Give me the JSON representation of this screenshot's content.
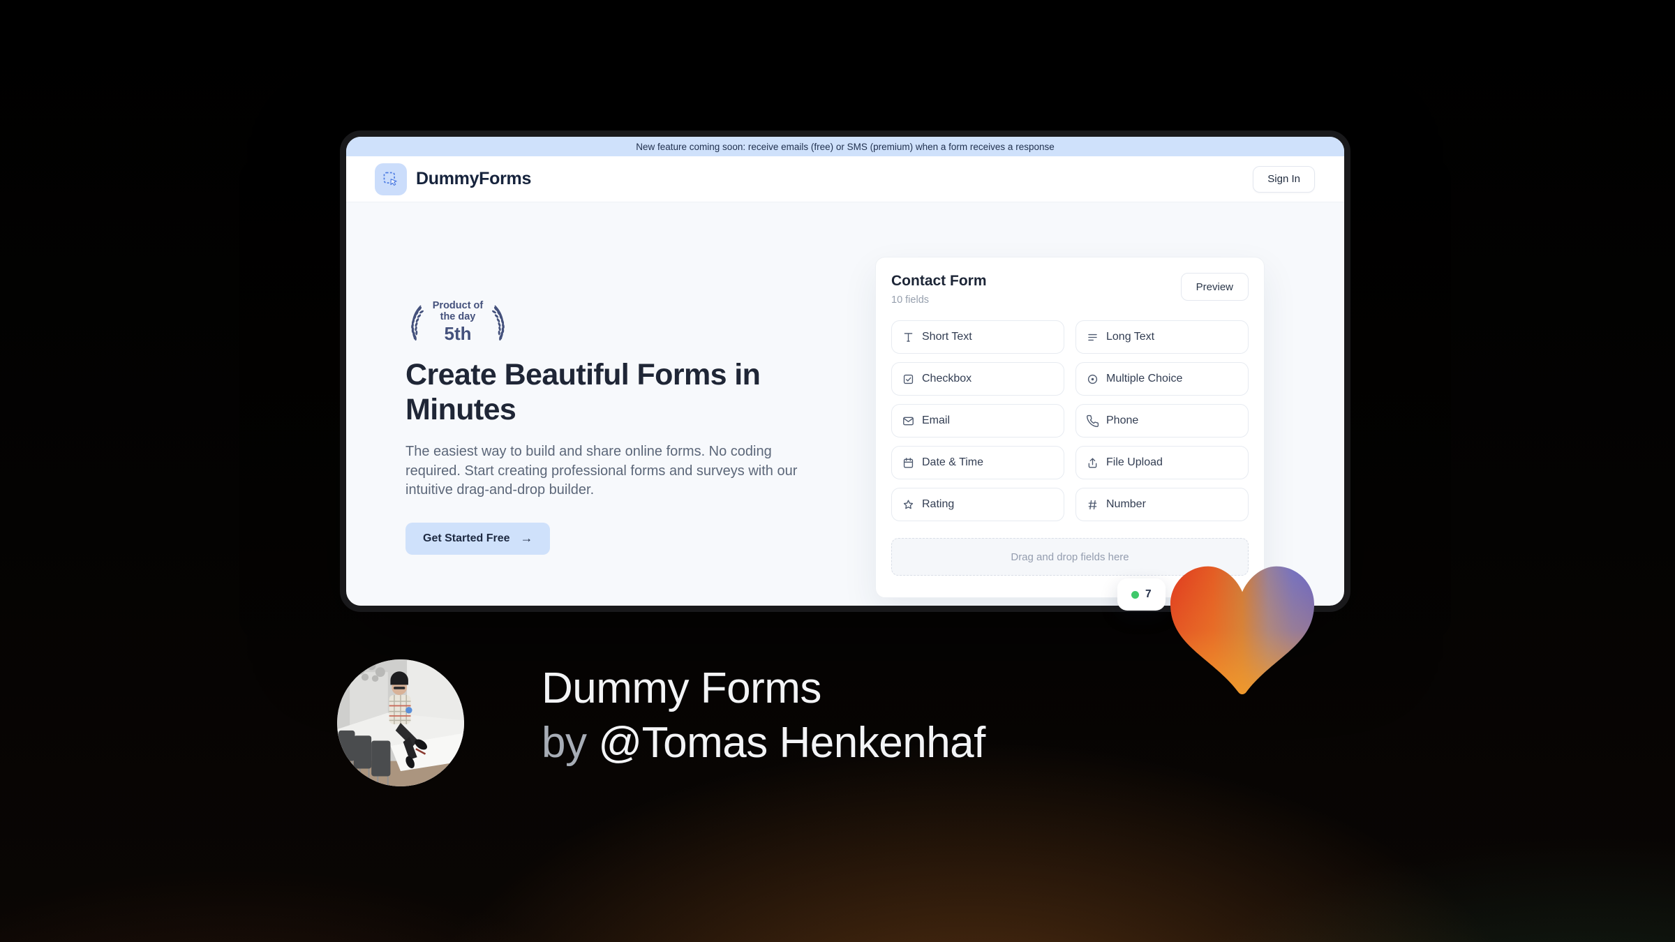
{
  "banner": {
    "text": "New feature coming soon: receive emails (free) or SMS (premium) when a form receives a response"
  },
  "header": {
    "brand": "DummyForms",
    "sign_in_label": "Sign In"
  },
  "hero": {
    "badge": {
      "title": "Product of the day",
      "rank": "5th"
    },
    "title": "Create Beautiful Forms in Minutes",
    "description": "The easiest way to build and share online forms. No coding required. Start creating professional forms and surveys with our intuitive drag-and-drop builder.",
    "cta_label": "Get Started Free",
    "cta_arrow": "→"
  },
  "form_builder": {
    "title": "Contact Form",
    "subtitle": "10 fields",
    "preview_label": "Preview",
    "fields": [
      {
        "label": "Short Text",
        "icon": "short-text-icon"
      },
      {
        "label": "Long Text",
        "icon": "long-text-icon"
      },
      {
        "label": "Checkbox",
        "icon": "checkbox-icon"
      },
      {
        "label": "Multiple Choice",
        "icon": "radio-icon"
      },
      {
        "label": "Email",
        "icon": "email-icon"
      },
      {
        "label": "Phone",
        "icon": "phone-icon"
      },
      {
        "label": "Date & Time",
        "icon": "calendar-icon"
      },
      {
        "label": "File Upload",
        "icon": "upload-icon"
      },
      {
        "label": "Rating",
        "icon": "star-icon"
      },
      {
        "label": "Number",
        "icon": "hash-icon"
      }
    ],
    "dropzone_text": "Drag and drop fields here",
    "status_badge": {
      "visible_text": "7",
      "dot_color": "#3fc86a"
    }
  },
  "footer": {
    "product_name": "Dummy Forms",
    "byline_prefix": "by",
    "author": "@Tomas Henkenhaf"
  },
  "colors": {
    "banner_bg": "#cfe1fb",
    "accent_blue": "#4d7ce2",
    "cta_bg": "#cfe1fb",
    "heading": "#1f2636",
    "body_text": "#5c6779",
    "laurel": "#44517c",
    "page_bg": "#000000",
    "glow_warm": "#a86022",
    "glow_green": "#26583c",
    "heart_red": "#e03a20",
    "heart_orange": "#f0992f",
    "heart_purple": "#6b68c6",
    "status_dot": "#3fc86a"
  }
}
